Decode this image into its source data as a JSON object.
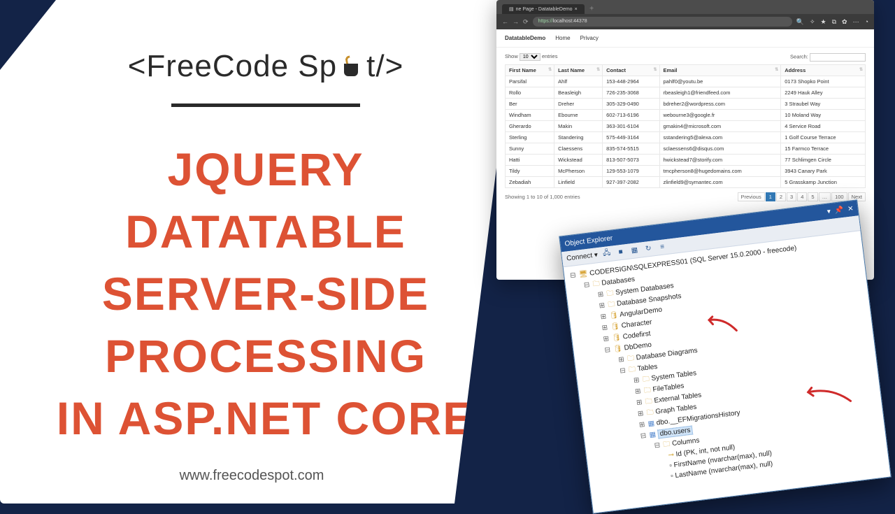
{
  "logo": {
    "text_left": "<FreeCode Sp",
    "text_right": "t/>"
  },
  "title_line1": "JQuery Datatable",
  "title_line2": "Server-side",
  "title_line3": "processing",
  "title_line4": "in ASP.NET Core",
  "footer_url": "www.freecodespot.com",
  "browser": {
    "tab_label": "ne Page - DatatableDemo",
    "url_prefix": "https://",
    "url_host": "localhost",
    "url_port": ":44378",
    "brand": "DatatableDemo",
    "nav_home": "Home",
    "nav_privacy": "Privacy",
    "len_prefix": "Show",
    "len_value": "10",
    "len_suffix": "entries",
    "search_label": "Search:",
    "columns": [
      "First Name",
      "Last Name",
      "Contact",
      "Email",
      "Address"
    ],
    "rows": [
      [
        "Parsifal",
        "Ahlf",
        "153-448-2964",
        "pahlf0@youtu.be",
        "0173 Shopko Point"
      ],
      [
        "Rollo",
        "Beasleigh",
        "726-235-3068",
        "rbeasleigh1@friendfeed.com",
        "2249 Hauk Alley"
      ],
      [
        "Ber",
        "Dreher",
        "305-329-0490",
        "bdreher2@wordpress.com",
        "3 Straubel Way"
      ],
      [
        "Windham",
        "Ebourne",
        "602-713-6196",
        "webourne3@google.fr",
        "10 Moland Way"
      ],
      [
        "Gherardo",
        "Makin",
        "363-301-6104",
        "gmakin4@microsoft.com",
        "4 Service Road"
      ],
      [
        "Sterling",
        "Standering",
        "575-449-3164",
        "sstandering5@alexa.com",
        "1 Golf Course Terrace"
      ],
      [
        "Sunny",
        "Claessens",
        "835-574-5515",
        "sclaessens6@disqus.com",
        "15 Farmco Terrace"
      ],
      [
        "Hatti",
        "Wickstead",
        "813-507-5073",
        "hwickstead7@storify.com",
        "77 Schlimgen Circle"
      ],
      [
        "Tildy",
        "McPherson",
        "129-553-1079",
        "tmcpherson8@hugedomains.com",
        "3943 Canary Park"
      ],
      [
        "Zebadiah",
        "Linfield",
        "927-397-2082",
        "zlinfield9@symantec.com",
        "5 Grasskamp Junction"
      ]
    ],
    "info_text": "Showing 1 to 10 of 1,000 entries",
    "pager_prev": "Previous",
    "pager_pages": [
      "1",
      "2",
      "3",
      "4",
      "5",
      "…",
      "100"
    ],
    "pager_next": "Next"
  },
  "ssms": {
    "title": "Object Explorer",
    "connect_label": "Connect ▾",
    "server": "CODERSIGN\\SQLEXPRESS01 (SQL Server 15.0.2000 - freecode)",
    "nodes": {
      "databases": "Databases",
      "sysdb": "System Databases",
      "snapshots": "Database Snapshots",
      "angular": "AngularDemo",
      "character": "Character",
      "codefirst": "Codefirst",
      "dbdemo": "DbDemo",
      "dbdiag": "Database Diagrams",
      "tables": "Tables",
      "systables": "System Tables",
      "filetables": "FileTables",
      "exttables": "External Tables",
      "graphtables": "Graph Tables",
      "efmig": "dbo.__EFMigrationsHistory",
      "users": "dbo.users",
      "columns": "Columns",
      "col_id": "Id (PK, int, not null)",
      "col_fn": "FirstName (nvarchar(max), null)",
      "col_ln": "LastName (nvarchar(max), null)"
    }
  }
}
